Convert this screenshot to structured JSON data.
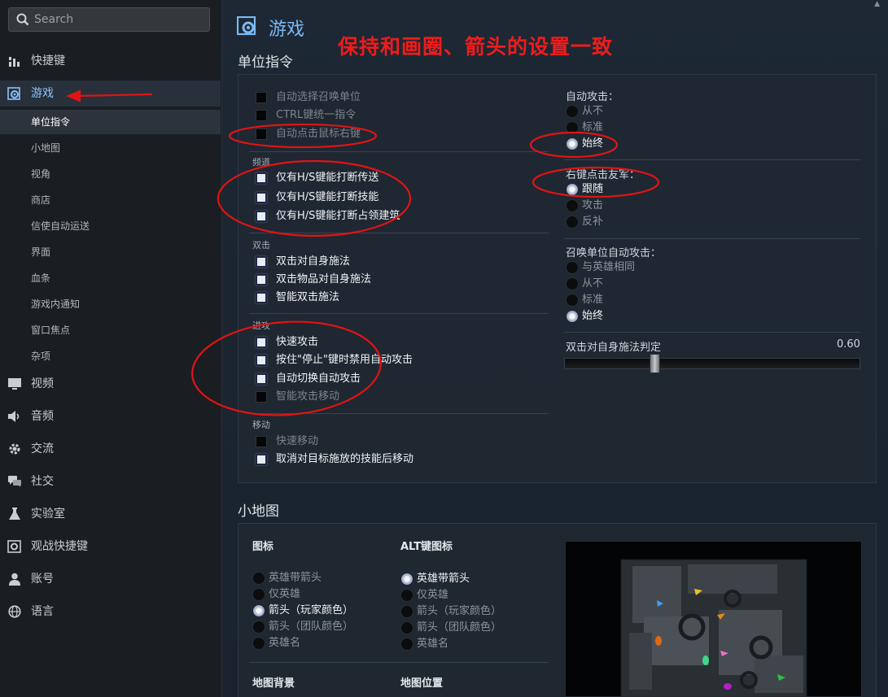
{
  "search": {
    "placeholder": "Search"
  },
  "sidebar": {
    "items": [
      {
        "key": "hotkeys",
        "label": "快捷键",
        "icon": "grid-icon"
      },
      {
        "key": "game",
        "label": "游戏",
        "icon": "gear-icon",
        "active": true
      },
      {
        "key": "video",
        "label": "视频",
        "icon": "monitor-icon"
      },
      {
        "key": "audio",
        "label": "音频",
        "icon": "speaker-icon"
      },
      {
        "key": "comm",
        "label": "交流",
        "icon": "gear-icon"
      },
      {
        "key": "social",
        "label": "社交",
        "icon": "chat-icon"
      },
      {
        "key": "lab",
        "label": "实验室",
        "icon": "flask-icon"
      },
      {
        "key": "spectator",
        "label": "观战快捷键",
        "icon": "eye-gear-icon"
      },
      {
        "key": "account",
        "label": "账号",
        "icon": "user-icon"
      },
      {
        "key": "language",
        "label": "语言",
        "icon": "globe-icon"
      }
    ],
    "subitems": [
      {
        "label": "单位指令",
        "selected": true
      },
      {
        "label": "小地图"
      },
      {
        "label": "视角"
      },
      {
        "label": "商店"
      },
      {
        "label": "信使自动运送"
      },
      {
        "label": "界面"
      },
      {
        "label": "血条"
      },
      {
        "label": "游戏内通知"
      },
      {
        "label": "窗口焦点"
      },
      {
        "label": "杂项"
      }
    ]
  },
  "page": {
    "title": "游戏",
    "annotation": "保持和画圈、箭头的设置一致"
  },
  "unit_orders": {
    "header": "单位指令",
    "top": [
      {
        "label": "自动选择召唤单位",
        "checked": false
      },
      {
        "label": "CTRL键统一指令",
        "checked": false
      },
      {
        "label": "自动点击鼠标右键",
        "checked": false
      }
    ],
    "channel": {
      "label": "频道",
      "items": [
        {
          "label": "仅有H/S键能打断传送",
          "checked": true
        },
        {
          "label": "仅有H/S键能打断技能",
          "checked": true
        },
        {
          "label": "仅有H/S键能打断占领建筑",
          "checked": true
        }
      ]
    },
    "double_tap": {
      "label": "双击",
      "items": [
        {
          "label": "双击对自身施法",
          "checked": true
        },
        {
          "label": "双击物品对自身施法",
          "checked": true
        },
        {
          "label": "智能双击施法",
          "checked": true
        }
      ]
    },
    "attack": {
      "label": "进攻",
      "items": [
        {
          "label": "快速攻击",
          "checked": true
        },
        {
          "label": "按住\"停止\"键时禁用自动攻击",
          "checked": true
        },
        {
          "label": "自动切换自动攻击",
          "checked": true
        },
        {
          "label": "智能攻击移动",
          "checked": false
        }
      ]
    },
    "move": {
      "label": "移动",
      "items": [
        {
          "label": "快速移动",
          "checked": false
        },
        {
          "label": "取消对目标施放的技能后移动",
          "checked": true
        }
      ]
    },
    "auto_attack": {
      "label": "自动攻击：",
      "options": [
        {
          "label": "从不",
          "selected": false
        },
        {
          "label": "标准",
          "selected": false
        },
        {
          "label": "始终",
          "selected": true
        }
      ]
    },
    "right_click_ally": {
      "label": "右键点击友军：",
      "options": [
        {
          "label": "跟随",
          "selected": true
        },
        {
          "label": "攻击",
          "selected": false
        },
        {
          "label": "反补",
          "selected": false
        }
      ]
    },
    "summon_auto_attack": {
      "label": "召唤单位自动攻击：",
      "options": [
        {
          "label": "与英雄相同",
          "selected": false
        },
        {
          "label": "从不",
          "selected": false
        },
        {
          "label": "标准",
          "selected": false
        },
        {
          "label": "始终",
          "selected": true
        }
      ]
    },
    "double_tap_threshold": {
      "label": "双击对自身施法判定",
      "value": "0.60",
      "fraction": 0.31
    }
  },
  "minimap": {
    "header": "小地图",
    "icons": {
      "label": "图标",
      "options": [
        {
          "label": "英雄带箭头",
          "selected": false
        },
        {
          "label": "仅英雄",
          "selected": false
        },
        {
          "label": "箭头（玩家颜色）",
          "selected": true
        },
        {
          "label": "箭头（团队颜色）",
          "selected": false
        },
        {
          "label": "英雄名",
          "selected": false
        }
      ]
    },
    "alt_icons": {
      "label": "ALT键图标",
      "options": [
        {
          "label": "英雄带箭头",
          "selected": true
        },
        {
          "label": "仅英雄",
          "selected": false
        },
        {
          "label": "箭头（玩家颜色）",
          "selected": false
        },
        {
          "label": "箭头（团队颜色）",
          "selected": false
        },
        {
          "label": "英雄名",
          "selected": false
        }
      ]
    },
    "background_label": "地图背景",
    "position_label": "地图位置"
  },
  "colors": {
    "accent": "#7db8f2",
    "annotation": "#ee1c1c"
  }
}
